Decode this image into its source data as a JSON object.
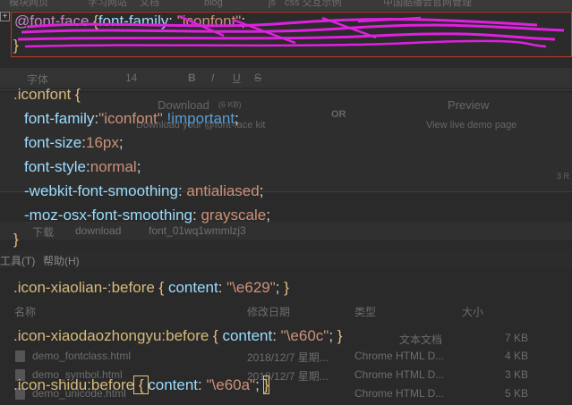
{
  "background_layers": {
    "bookmarks": [
      "模块网页",
      "学习网站",
      "文档",
      "blog",
      "js",
      "css 交互示例",
      "中国酷播会官网管理"
    ],
    "doc_toolbar": {
      "font_label": "字体",
      "size_label": "14",
      "buttons": [
        "B",
        "I",
        "U",
        "S"
      ]
    },
    "download_pane": {
      "download_label": "Download",
      "download_size": "(6 KB)",
      "download_sub": "Download your @font-face kit",
      "or_label": "OR",
      "preview_label": "Preview",
      "preview_sub": "View live demo page",
      "page_num": "3 R"
    },
    "address_bar": {
      "segments": [
        "下载",
        "download",
        "font_01wq1wmmlzj3"
      ]
    },
    "menubar": {
      "items": [
        "工具(T)",
        "帮助(H)"
      ]
    },
    "file_header": {
      "name": "名称",
      "date": "修改日期",
      "type": "类型",
      "size": "大小"
    },
    "files": [
      {
        "name": "",
        "date": "",
        "type": "文本文档",
        "size": "7 KB"
      },
      {
        "name": "demo_fontclass.html",
        "date": "2018/12/7 星期...",
        "type": "Chrome HTML D...",
        "size": "4 KB"
      },
      {
        "name": "demo_symbol.html",
        "date": "2018/12/7 星期...",
        "type": "Chrome HTML D...",
        "size": "3 KB"
      },
      {
        "name": "demo_unicode.html",
        "date": "",
        "type": "Chrome HTML D...",
        "size": "5 KB"
      }
    ]
  },
  "fontface_block": {
    "gutter_icon": "+",
    "at_rule": "@font-face",
    "open_brace": " {",
    "prop": "font-family",
    "colon": ": ",
    "value": "\"iconfont\"",
    "tail": "; ...",
    "close_brace": "}"
  },
  "iconfont_rule": {
    "selector": ".iconfont",
    "open_brace": " {",
    "declarations": [
      {
        "prop": "font-family",
        "sep": ":",
        "value": "\"iconfont\"",
        "important": " !important",
        "end": ";"
      },
      {
        "prop": "font-size",
        "sep": ":",
        "value": "16px",
        "important": "",
        "end": ";"
      },
      {
        "prop": "font-style",
        "sep": ":",
        "value": "normal",
        "important": "",
        "end": ";"
      },
      {
        "prop": "-webkit-font-smoothing",
        "sep": ": ",
        "value": "antialiased",
        "important": "",
        "end": ";"
      },
      {
        "prop": "-moz-osx-font-smoothing",
        "sep": ": ",
        "value": "grayscale",
        "important": "",
        "end": ";"
      }
    ],
    "close_brace": "}"
  },
  "icon_rules": [
    {
      "selector": ".icon-xiaolian-:before",
      "open": " { ",
      "prop": "content",
      "sep": ": ",
      "value": "\"\\e629\"",
      "end": "; ",
      "close": "}"
    },
    {
      "selector": ".icon-xiaodaozhongyu:before",
      "open": " { ",
      "prop": "content",
      "sep": ": ",
      "value": "\"\\e60c\"",
      "end": "; ",
      "close": "}"
    },
    {
      "selector": ".icon-shidu:before",
      "open": " { ",
      "prop": "content",
      "sep": ": ",
      "value": "\"\\e60a\"",
      "end": "; ",
      "close": "}"
    }
  ],
  "colors": {
    "selector": "#d7ba7d",
    "brace": "#e5c07b",
    "property": "#9cdcfe",
    "value": "#ce9178",
    "important": "#569cd6",
    "highlight_box": "#c0392b",
    "scribble": "#e020e0"
  }
}
